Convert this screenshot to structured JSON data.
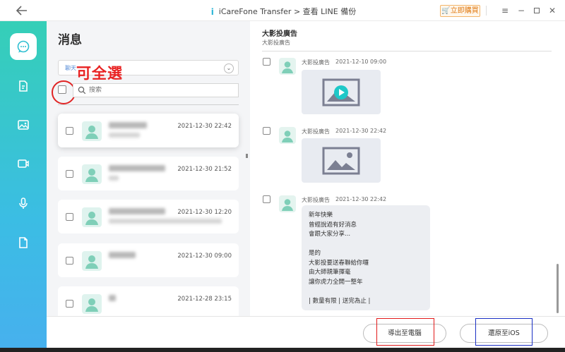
{
  "titlebar": {
    "back_icon": "arrow-left-icon",
    "app_name": "iCareFone Transfer",
    "separator": ">",
    "page": "查看 LINE 備份",
    "buy_label": "立即購買",
    "controls": [
      "menu-icon",
      "minimize-icon",
      "maximize-icon",
      "close-icon"
    ]
  },
  "sidebar": {
    "items": [
      {
        "icon": "chat-bubble-icon",
        "active": true
      },
      {
        "icon": "document-icon",
        "active": false
      },
      {
        "icon": "image-icon",
        "active": false
      },
      {
        "icon": "video-icon",
        "active": false
      },
      {
        "icon": "microphone-icon",
        "active": false
      },
      {
        "icon": "file-icon",
        "active": false
      }
    ]
  },
  "list_panel": {
    "title": "消息",
    "dropdown_value": "聊天",
    "search_placeholder": "搜索",
    "annotation": "可全選",
    "conversations": [
      {
        "time": "2021-12-30 22:42"
      },
      {
        "time": "2021-12-30 21:52"
      },
      {
        "time": "2021-12-30 12:20"
      },
      {
        "time": "2021-12-30 09:00"
      },
      {
        "time": "2021-12-28 23:15"
      }
    ]
  },
  "message_panel": {
    "contact_name": "大影投廣告",
    "contact_sub": "大影投廣告",
    "messages": [
      {
        "sender": "大影投廣告",
        "time": "2021-12-10 09:00",
        "kind": "video"
      },
      {
        "sender": "大影投廣告",
        "time": "2021-12-30 22:42",
        "kind": "image"
      },
      {
        "sender": "大影投廣告",
        "time": "2021-12-30 22:42",
        "kind": "text",
        "lines": [
          "新年快樂",
          "曾經說過有好消息",
          "會跟大家分享...",
          "",
          "是的",
          "大影投要送春聯給你囉",
          "由大師親筆揮毫",
          "讓你虎力全開一整年",
          "",
          "| 數量有限 | 送完為止 |"
        ]
      }
    ]
  },
  "footer": {
    "export_label": "導出至電腦",
    "restore_label": "還原至iOS"
  },
  "colors": {
    "sidebar_top": "#35cfb7",
    "sidebar_bottom": "#47b0ee",
    "annotation_red": "#e21a1a",
    "annotation_blue": "#1a2fc4",
    "buy_orange": "#e07a12"
  }
}
